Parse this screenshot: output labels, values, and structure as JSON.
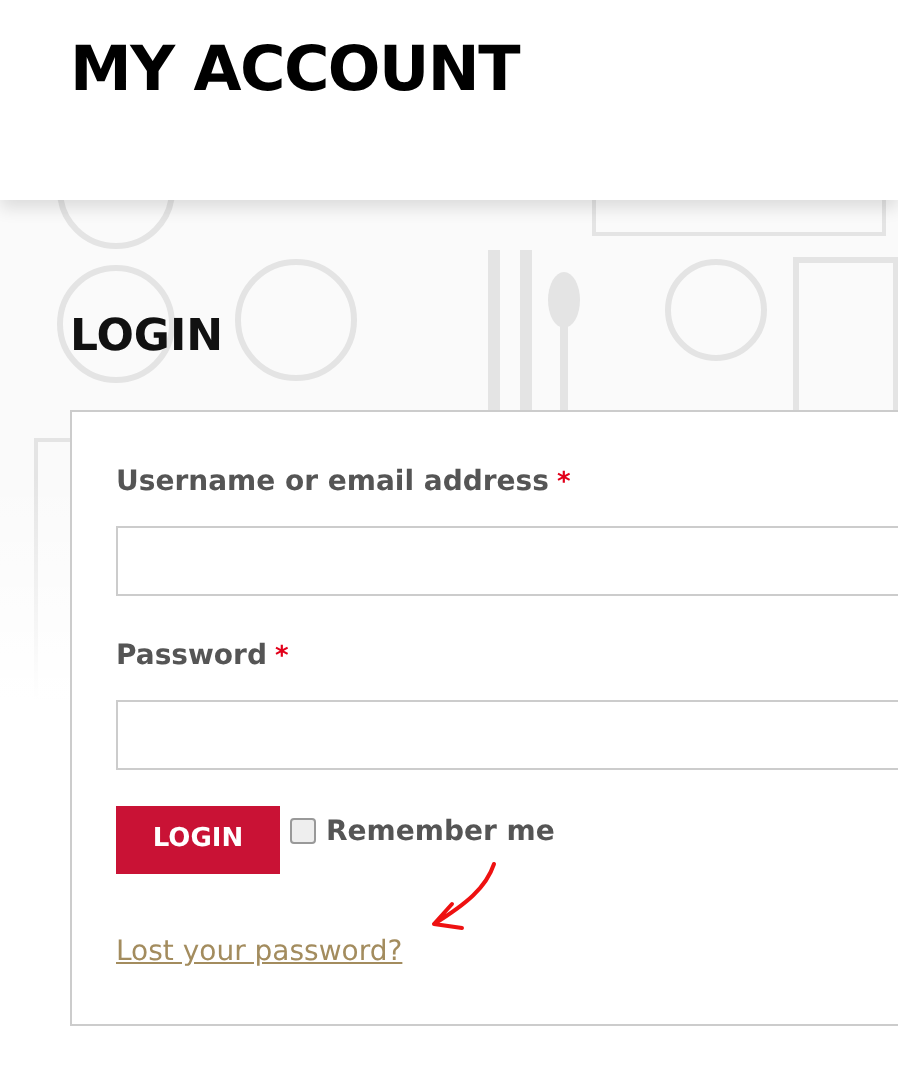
{
  "page_title": "MY ACCOUNT",
  "section_title": "LOGIN",
  "form": {
    "fields": [
      {
        "label": "Username or email address",
        "required_mark": "*"
      },
      {
        "label": "Password",
        "required_mark": "*"
      }
    ],
    "submit": "LOGIN",
    "remember": {
      "label": "Remember me",
      "checked": false
    },
    "lost_password_link": "Lost your password?"
  }
}
